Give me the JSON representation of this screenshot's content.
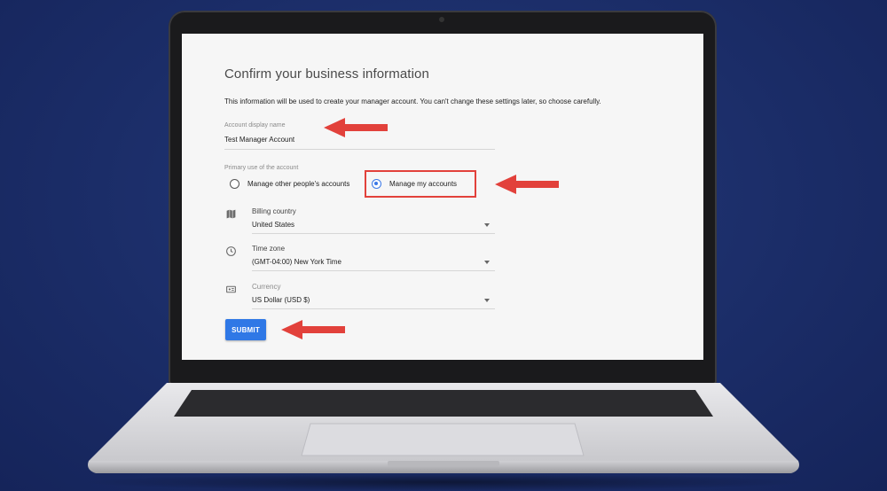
{
  "form": {
    "title": "Confirm your business information",
    "description": "This information will be used to create your manager account. You can't change these settings later, so choose carefully.",
    "account_name": {
      "label": "Account display name",
      "value": "Test Manager Account"
    },
    "primary_use": {
      "label": "Primary use of the account",
      "options": [
        {
          "label": "Manage other people's accounts",
          "selected": false
        },
        {
          "label": "Manage my accounts",
          "selected": true
        }
      ]
    },
    "billing_country": {
      "label": "Billing country",
      "value": "United States",
      "icon": "map-icon"
    },
    "time_zone": {
      "label": "Time zone",
      "value": "(GMT-04:00) New York Time",
      "icon": "clock-icon"
    },
    "currency": {
      "label": "Currency",
      "value": "US Dollar (USD $)",
      "icon": "currency-icon"
    },
    "submit_label": "SUBMIT"
  },
  "colors": {
    "background": "#1b2d68",
    "accent": "#2f78e6",
    "annotation": "#e2413b"
  }
}
